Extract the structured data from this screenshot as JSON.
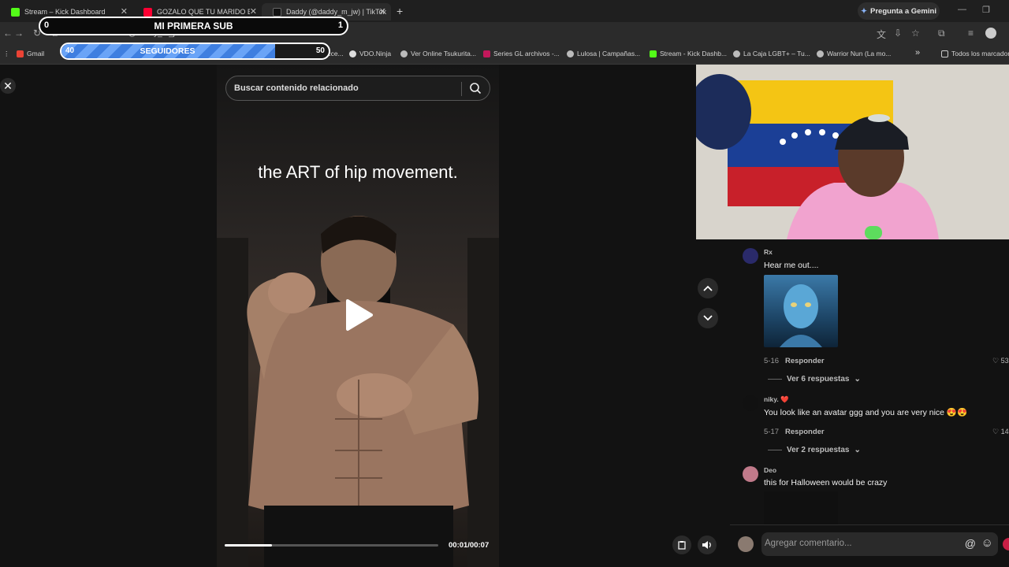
{
  "browser": {
    "tabs": [
      {
        "title": "Stream – Kick Dashboard",
        "favicon_color": "#53fc18",
        "active": false
      },
      {
        "title": "GOZALO QUE TU MARIDO ESTÁ",
        "favicon_color": "#ff0033",
        "active": false
      },
      {
        "title": "Daddy (@daddy_m_jw) | TikTok",
        "favicon_color": "#111111",
        "active": true
      }
    ],
    "new_tab_icon": "plus-icon",
    "gemini_label": "Pregunta a Gemini",
    "url": "tiktok.com/@daddy_m_jw/video/7640510703241153822",
    "bookmarks": [
      {
        "label": "Gmail",
        "color": "#ea4335"
      },
      {
        "label": "Pro Evolution Socce...",
        "color": "#888888"
      },
      {
        "label": "VDO.Ninja",
        "color": "#cccccc"
      },
      {
        "label": "Ver Online Tsukurita...",
        "color": "#cccccc"
      },
      {
        "label": "Series GL archivos -...",
        "color": "#c2185b"
      },
      {
        "label": "Lulosa | Campañas...",
        "color": "#cccccc"
      },
      {
        "label": "Stream - Kick Dashb...",
        "color": "#53fc18"
      },
      {
        "label": "La Caja LGBT+ – Tu...",
        "color": "#cccccc"
      },
      {
        "label": "Warrior Nun (La mo...",
        "color": "#cccccc"
      }
    ],
    "bookmarks_more": "»",
    "all_bookmarks": "Todos los marcadores"
  },
  "overlays": {
    "sub_goal": {
      "title": "MI PRIMERA SUB",
      "min": "0",
      "max": "1"
    },
    "follow_goal": {
      "title": "SEGUIDORES",
      "current": "40",
      "goal": "50",
      "progress_fraction": 0.8
    }
  },
  "video": {
    "search_placeholder": "Buscar contenido relacionado",
    "caption": "the ART of hip movement.",
    "timecode": "00:01/00:07",
    "progress_fraction": 0.22
  },
  "comments": [
    {
      "user": "Rx",
      "text": "Hear me out....",
      "date": "5-16",
      "reply": "Responder",
      "likes": "53",
      "view_replies": "Ver 6 respuestas",
      "avatar_color": "#2a2a6a"
    },
    {
      "user": "niky. ❤️",
      "text": "You look like an avatar ggg and you are very nice 😍😍",
      "date": "5-17",
      "reply": "Responder",
      "likes": "14",
      "view_replies": "Ver 2 respuestas",
      "avatar_color": "#111111"
    },
    {
      "user": "Deo",
      "text": "this for Halloween would be crazy",
      "avatar_color": "#c07a8a"
    }
  ],
  "comment_input_placeholder": "Agregar comentario..."
}
